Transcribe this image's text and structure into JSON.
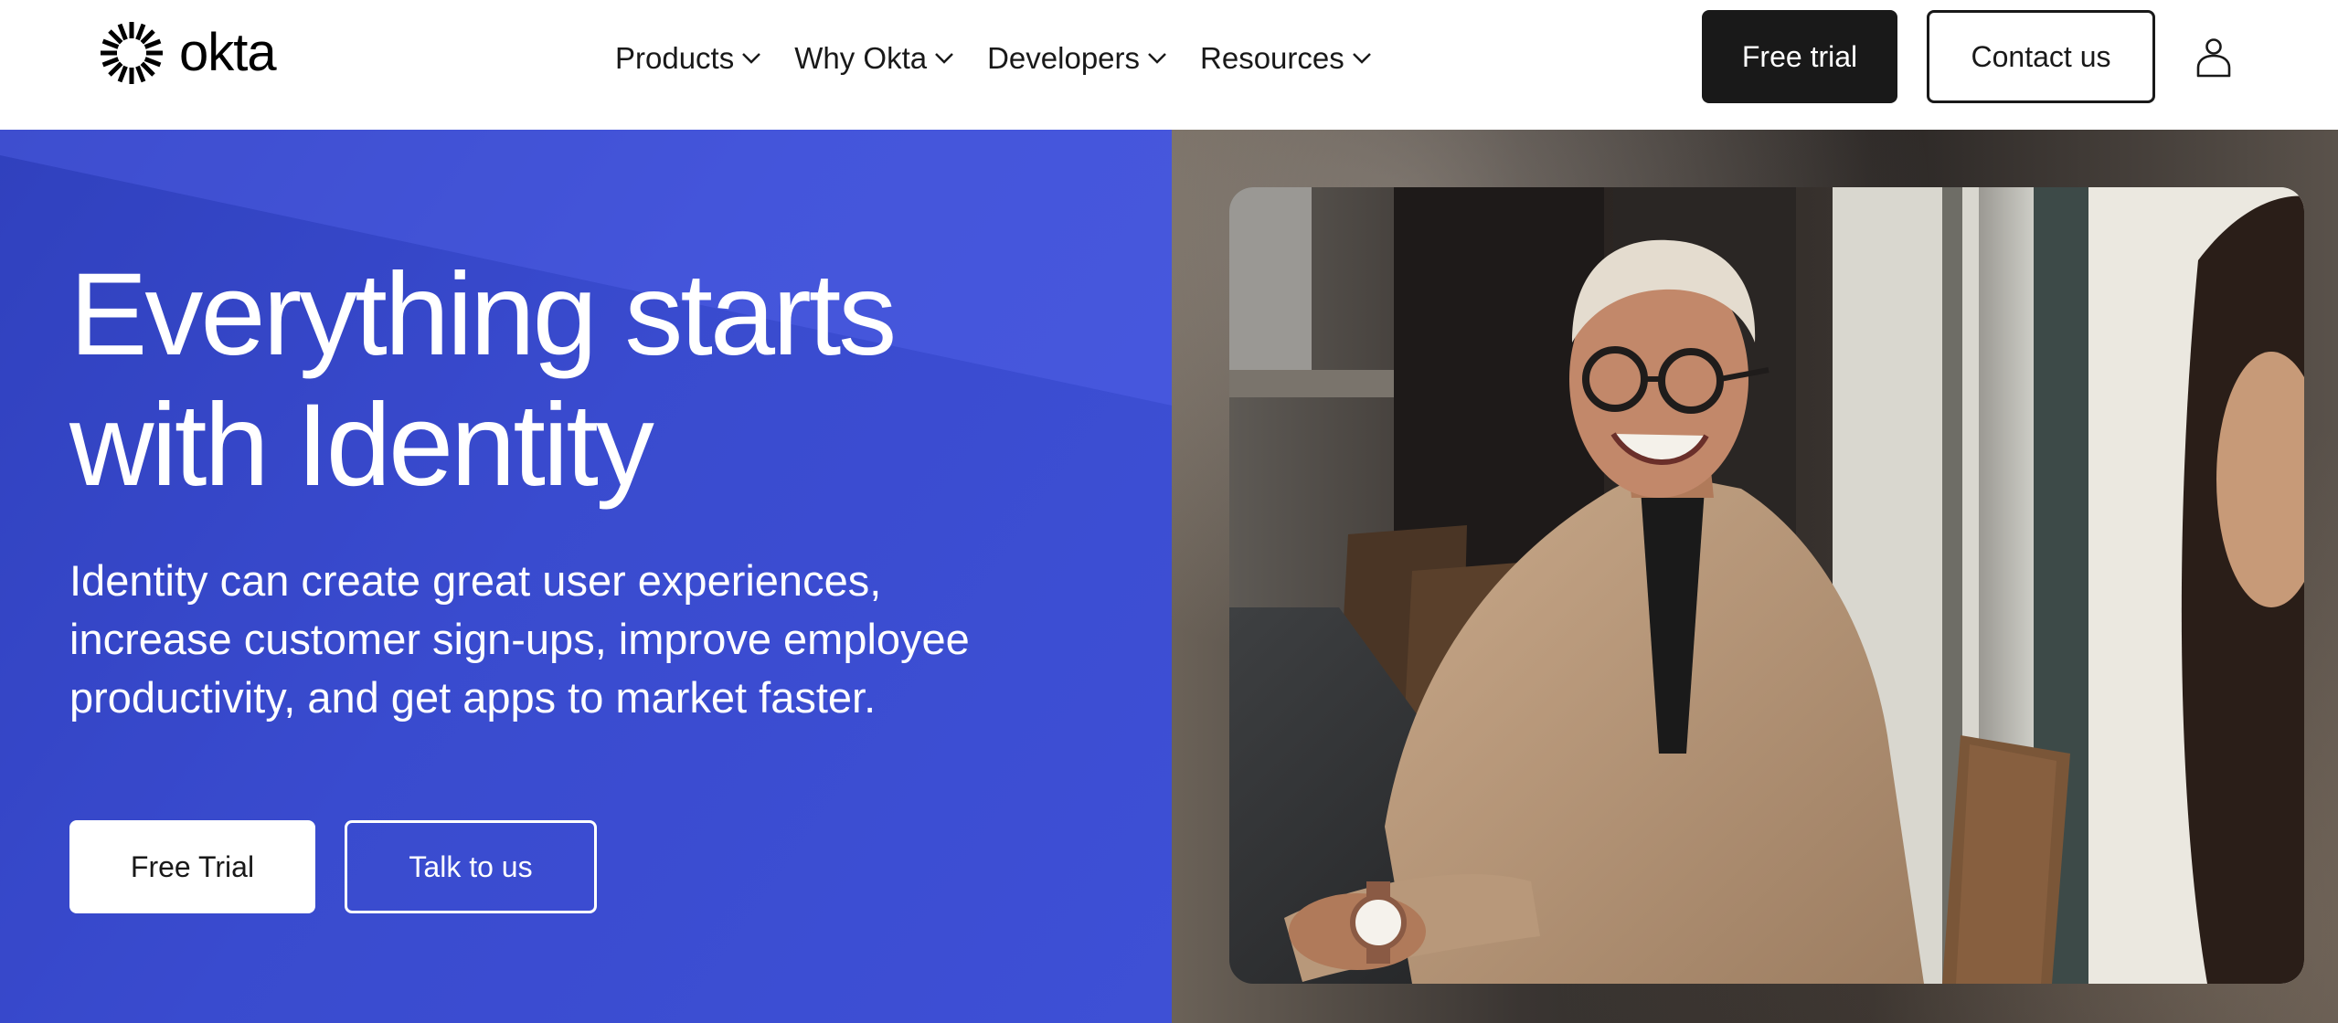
{
  "header": {
    "logo_text": "okta",
    "nav": [
      {
        "label": "Products"
      },
      {
        "label": "Why Okta"
      },
      {
        "label": "Developers"
      },
      {
        "label": "Resources"
      }
    ],
    "free_trial_label": "Free trial",
    "contact_label": "Contact us",
    "user_icon": "user-icon"
  },
  "hero": {
    "title_line1": "Everything starts",
    "title_line2": "with Identity",
    "subtitle_line1": "Identity can create great user experiences,",
    "subtitle_line2": "increase customer sign-ups, improve employee",
    "subtitle_line3": "productivity, and get apps to market faster.",
    "primary_cta": "Free Trial",
    "secondary_cta": "Talk to us"
  },
  "image": {
    "subject": "smiling-person-at-meeting-table-photo"
  },
  "colors": {
    "hero_blue": "#3d4fd4",
    "dark_button": "#191919",
    "white": "#ffffff"
  }
}
